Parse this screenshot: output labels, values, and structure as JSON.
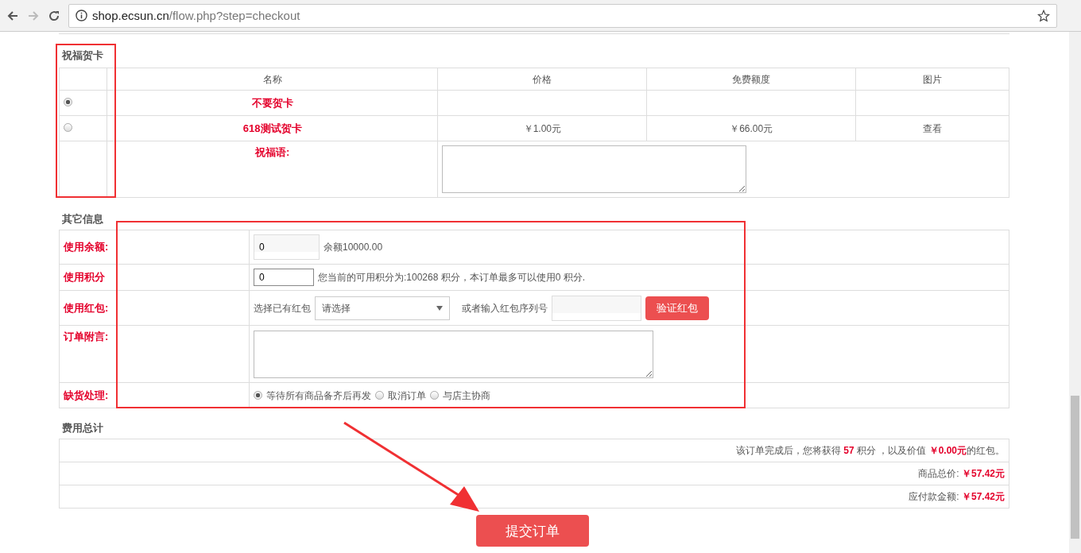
{
  "browser": {
    "url_host": "shop.ecsun.cn",
    "url_path": "/flow.php?step=checkout"
  },
  "card_section": {
    "title": "祝福贺卡",
    "columns": [
      "名称",
      "价格",
      "免费额度",
      "图片"
    ],
    "cards": [
      {
        "name": "不要贺卡",
        "selected": true
      },
      {
        "name": "618测试贺卡",
        "price": "￥1.00元",
        "free": "￥66.00元",
        "image": "查看",
        "selected": false
      }
    ],
    "message_label": "祝福语:"
  },
  "other_section": {
    "title": "其它信息",
    "rows": [
      {
        "kind": "balance",
        "label": "使用余额:",
        "value": "0",
        "note": "余额10000.00"
      },
      {
        "kind": "points",
        "label": "使用积分",
        "value": "0",
        "note": "您当前的可用积分为:100268 积分，本订单最多可以使用0 积分."
      },
      {
        "kind": "bonus",
        "label": "使用红包:",
        "select_label": "选择已有红包",
        "select_value": "请选择",
        "serial_label": "或者输入红包序列号",
        "button": "验证红包"
      },
      {
        "kind": "note",
        "label": "订单附言:"
      },
      {
        "kind": "shortage",
        "label": "缺货处理:",
        "options": [
          {
            "label": "等待所有商品备齐后再发",
            "selected": true
          },
          {
            "label": "取消订单",
            "selected": false
          },
          {
            "label": "与店主协商",
            "selected": false
          }
        ]
      }
    ]
  },
  "total_section": {
    "title": "费用总计",
    "summary": "该订单完成后，您将获得 **57** 积分 ，以及价值 **￥0.00元**的红包。",
    "lines": [
      {
        "label": "商品总价:",
        "amount": "￥57.42元"
      },
      {
        "label": "应付款金额:",
        "amount": "￥57.42元"
      }
    ]
  },
  "submit_button": "提交订单"
}
